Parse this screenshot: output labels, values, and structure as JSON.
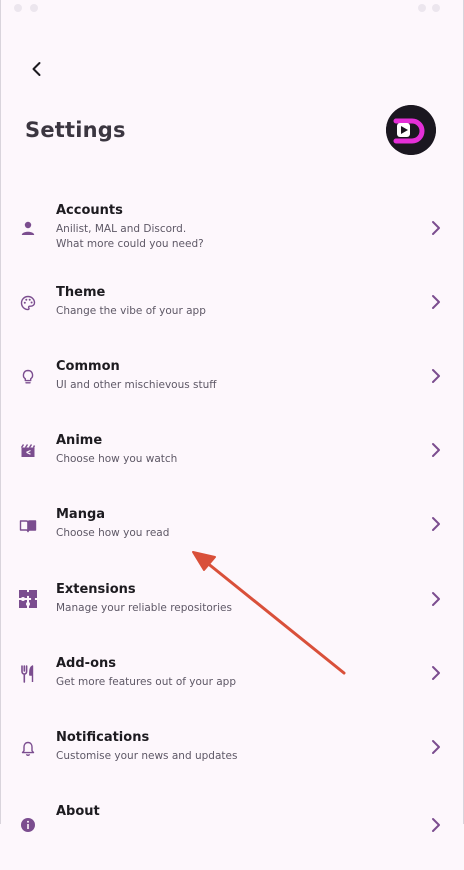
{
  "header": {
    "title": "Settings",
    "back_icon": "arrow-back-icon",
    "avatar_logo": "dantotsu-logo"
  },
  "colors": {
    "background": "#fdf7fc",
    "accent": "#7b4d8f",
    "logo_pink": "#e52fd8",
    "annotation_arrow": "#d9503a"
  },
  "settings": {
    "items": [
      {
        "title": "Accounts",
        "description": "Anilist, MAL and Discord.\nWhat more could you need?",
        "icon": "person-icon"
      },
      {
        "title": "Theme",
        "description": "Change the vibe of your app",
        "icon": "palette-icon"
      },
      {
        "title": "Common",
        "description": "UI and other mischievous stuff",
        "icon": "lightbulb-icon"
      },
      {
        "title": "Anime",
        "description": "Choose how you watch",
        "icon": "movie-icon"
      },
      {
        "title": "Manga",
        "description": "Choose how you read",
        "icon": "book-icon"
      },
      {
        "title": "Extensions",
        "description": "Manage your reliable repositories",
        "icon": "extension-icon"
      },
      {
        "title": "Add-ons",
        "description": "Get more features out of your app",
        "icon": "restaurant-icon"
      },
      {
        "title": "Notifications",
        "description": "Customise your news and updates",
        "icon": "bell-icon"
      },
      {
        "title": "About",
        "description": "",
        "icon": "info-icon"
      }
    ]
  }
}
